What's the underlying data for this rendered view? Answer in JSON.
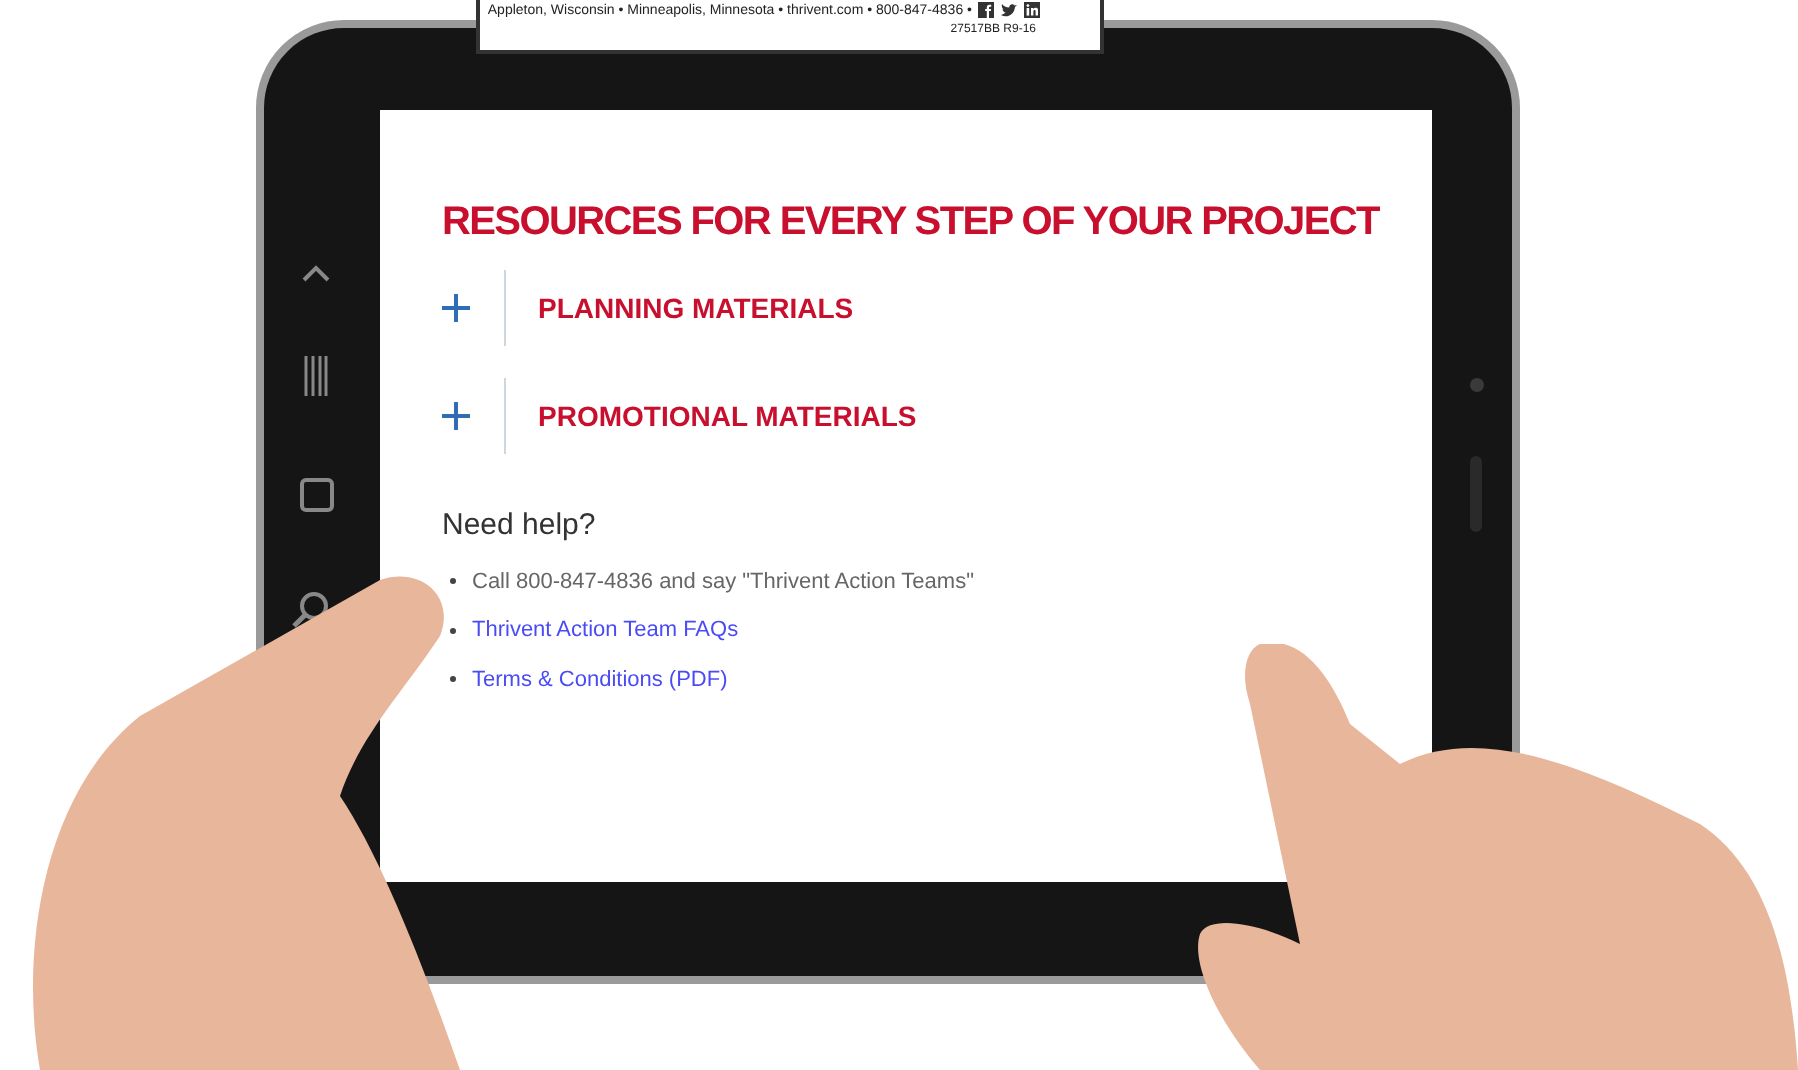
{
  "paper_strip": {
    "address": "Appleton, Wisconsin • Minneapolis, Minnesota • thrivent.com • 800-847-4836 •",
    "code": "27517BB R9-16"
  },
  "page": {
    "heading": "RESOURCES FOR EVERY STEP OF YOUR PROJECT",
    "sections": [
      {
        "label": "PLANNING MATERIALS",
        "expanded": false
      },
      {
        "label": "PROMOTIONAL MATERIALS",
        "expanded": false
      }
    ],
    "help": {
      "title": "Need help?",
      "items": [
        {
          "kind": "text",
          "text": "Call 800-847-4836 and say \"Thrivent Action Teams\""
        },
        {
          "kind": "link",
          "text": "Thrivent Action Team FAQs"
        },
        {
          "kind": "link",
          "text": "Terms & Conditions (PDF)"
        }
      ]
    }
  }
}
